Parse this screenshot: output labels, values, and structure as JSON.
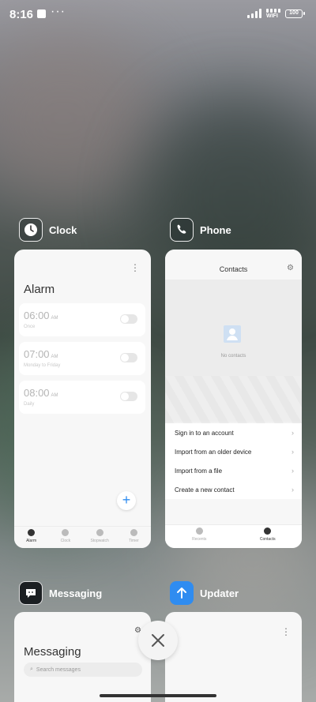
{
  "status_bar": {
    "time": "8:16",
    "overflow": "···",
    "wifi_label": "WIFI",
    "battery": "100"
  },
  "apps": {
    "clock": {
      "name": "Clock",
      "icon": "clock-icon",
      "screen_title": "Alarm",
      "alarms": [
        {
          "time": "06:00",
          "ampm": "AM",
          "label": "Once"
        },
        {
          "time": "07:00",
          "ampm": "AM",
          "label": "Monday to Friday"
        },
        {
          "time": "08:00",
          "ampm": "AM",
          "label": "Daily"
        }
      ],
      "add_symbol": "+",
      "tabs": [
        "Alarm",
        "Clock",
        "Stopwatch",
        "Timer"
      ]
    },
    "phone": {
      "name": "Phone",
      "icon": "phone-icon",
      "screen_title": "Contacts",
      "empty_text": "No contacts",
      "menu": [
        "Sign in to an account",
        "Import from an older device",
        "Import from a file",
        "Create a new contact"
      ],
      "tabs": [
        "Recents",
        "Contacts"
      ]
    },
    "messaging": {
      "name": "Messaging",
      "icon": "message-icon",
      "screen_title": "Messaging",
      "search_placeholder": "Search messages"
    },
    "updater": {
      "name": "Updater",
      "icon": "arrow-up-icon"
    }
  },
  "colors": {
    "accent": "#2f8cf0",
    "card": "#f7f7f7"
  }
}
